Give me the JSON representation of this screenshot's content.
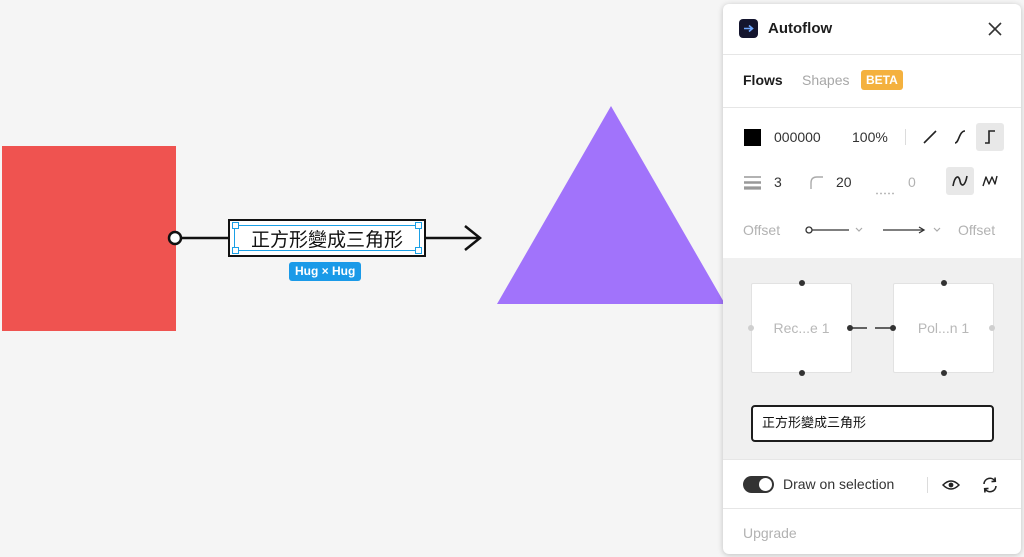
{
  "canvas": {
    "shapes": [
      {
        "type": "rectangle",
        "color": "#ef5350"
      },
      {
        "type": "triangle",
        "color": "#a173fb"
      }
    ],
    "text_node": {
      "text": "正方形變成三角形"
    },
    "size_badge": "Hug × Hug",
    "selection_color": "#1aa0e6"
  },
  "panel": {
    "title": "Autoflow",
    "tabs": [
      {
        "label": "Flows",
        "active": true
      },
      {
        "label": "Shapes",
        "active": false
      }
    ],
    "beta_badge": "BETA",
    "style": {
      "color_hex": "000000",
      "opacity": "100%",
      "stroke_width": "3",
      "corner_radius": "20",
      "dash": "0",
      "path_types": [
        "straight-line-icon",
        "curve-line-icon",
        "step-line-icon"
      ],
      "active_path_type": "step-line-icon",
      "line_styles": [
        "smooth-squiggle-icon",
        "squiggle-icon"
      ],
      "active_line_style": "smooth-squiggle-icon",
      "offset_start_label": "Offset",
      "offset_end_label": "Offset"
    },
    "preview": {
      "source_label": "Rec...e 1",
      "target_label": "Pol...n 1",
      "text_field_value": "正方形變成三角形"
    },
    "footer": {
      "draw_on_selection_label": "Draw on selection",
      "draw_on_selection": true,
      "upgrade_label": "Upgrade"
    }
  }
}
